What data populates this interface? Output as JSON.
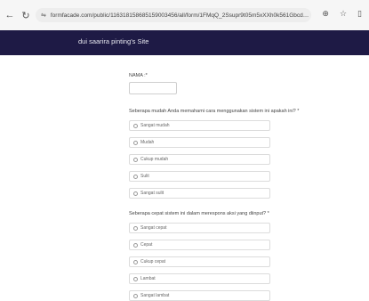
{
  "browser": {
    "url": "formfacade.com/public/116318158685159003456/all/form/1FMqQ_2Ssupr9t05m5xXXh0k561Gbcdc-47uam9W1hcs_rkd-l-lj24eQ",
    "back_glyph": "←",
    "reload_glyph": "↻",
    "tune_glyph": "⇋",
    "zoom_glyph": "⊕",
    "star_glyph": "☆",
    "ext_glyph": "▯"
  },
  "site": {
    "title": "dui saarira pinting's Site"
  },
  "form": {
    "name_label": "NAMA :*",
    "q1": {
      "label": "Seberapa mudah Anda memahami cara menggunakan sistem ini apakah ini? *",
      "options": [
        "Sangat mudah",
        "Mudah",
        "Cukup mudah",
        "Sulit",
        "Sangat sulit"
      ]
    },
    "q2": {
      "label": "Seberapa cepat sistem ini dalam merespons aksi yang diinput? *",
      "options": [
        "Sangat cepat",
        "Cepat",
        "Cukup cepat",
        "Lambat",
        "Sangat lambat"
      ]
    }
  }
}
